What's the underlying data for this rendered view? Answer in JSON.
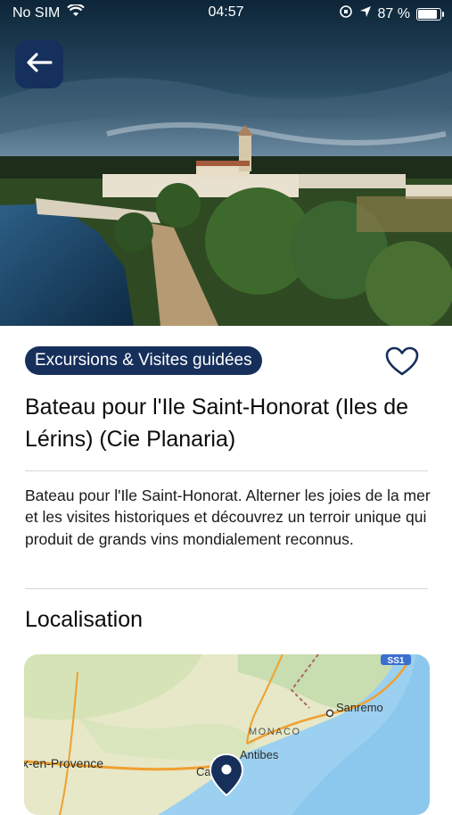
{
  "status_bar": {
    "carrier": "No SIM",
    "time": "04:57",
    "battery_percent": "87 %",
    "battery_level": 0.87
  },
  "hero": {
    "image_icon": "monastery-aerial-photo"
  },
  "header": {
    "back_icon": "arrow-left-icon"
  },
  "category": {
    "label": "Excursions & Visites guidées",
    "color": "#162f5b"
  },
  "favorite": {
    "icon": "heart-outline-icon"
  },
  "title": "Bateau pour l'Ile Saint-Honorat (Iles de Lérins) (Cie Planaria)",
  "description": "Bateau pour l'Ile Saint-Honorat. Alterner les joies de la mer et les visites historiques et découvrez un terroir unique qui produit de grands vins mondialement reconnus.",
  "location": {
    "section_title": "Localisation",
    "map": {
      "labels": {
        "highway": "SS1",
        "sanremo": "Sanremo",
        "monaco": "MONACO",
        "antibes": "Antibes",
        "provence": "x-en-Provence",
        "cannes": "Canne"
      },
      "pin_icon": "map-pin-icon"
    }
  }
}
